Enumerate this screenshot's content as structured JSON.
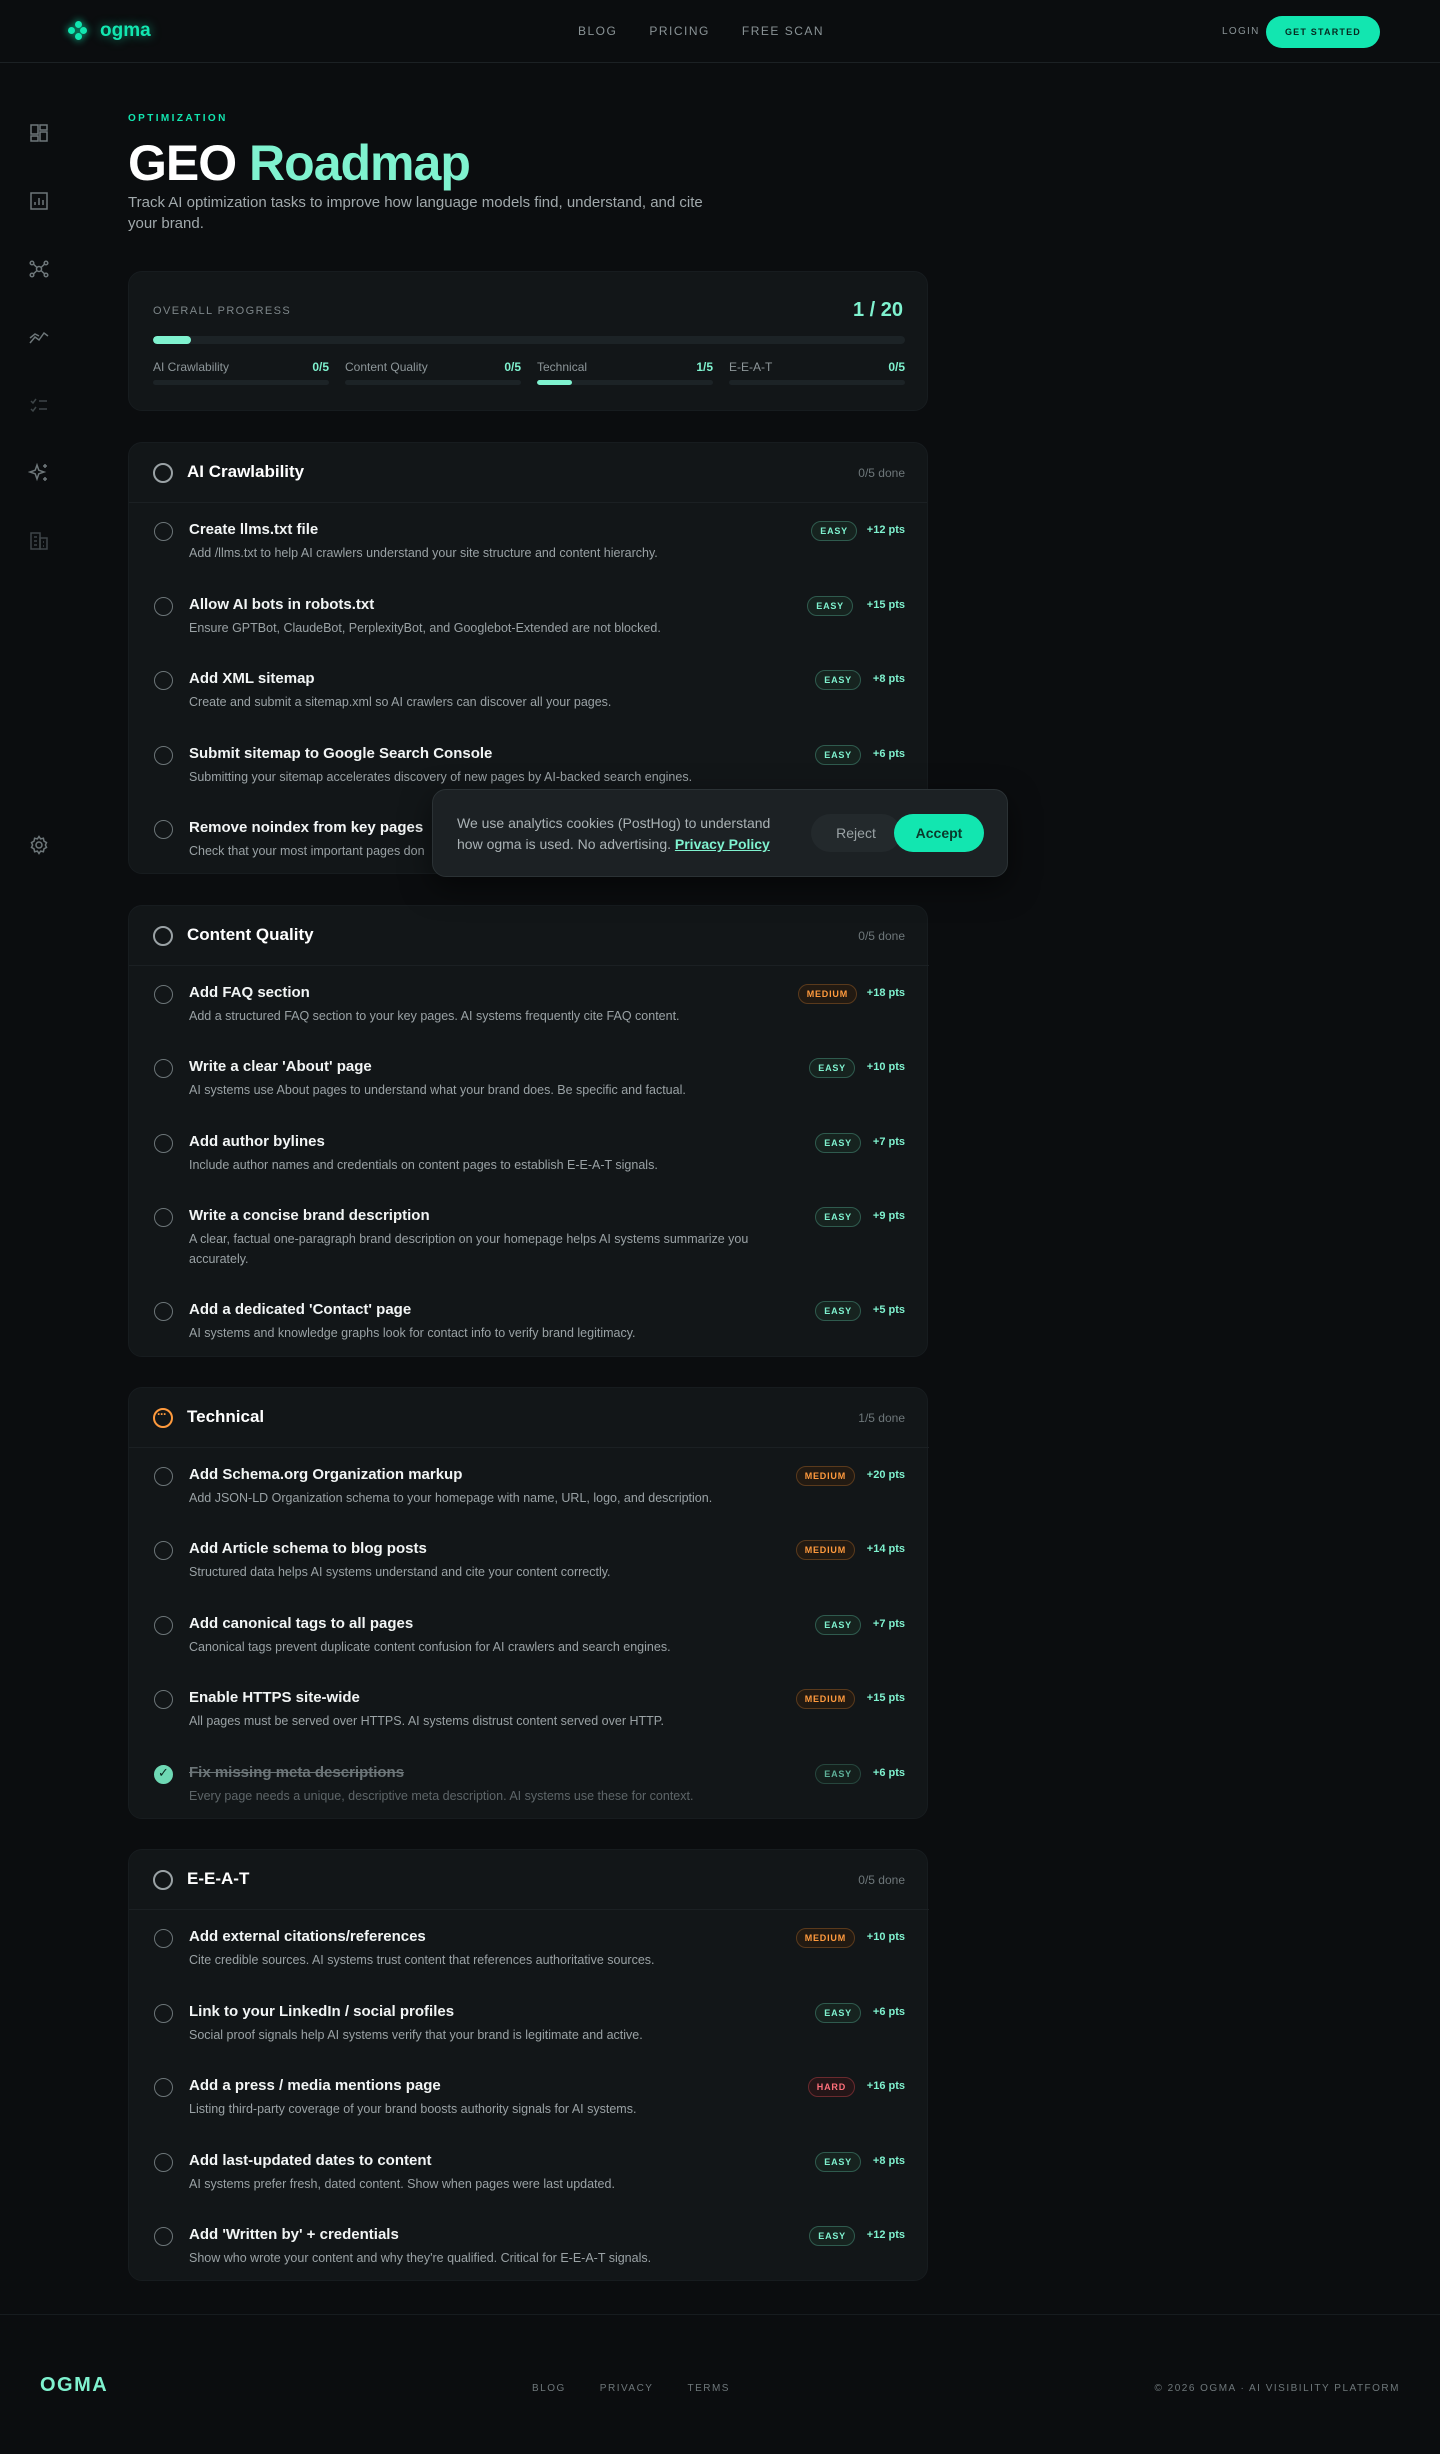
{
  "nav": {
    "logo_text": "ogma",
    "links": [
      "BLOG",
      "PRICING",
      "FREE SCAN"
    ],
    "login": "LOGIN",
    "cta": "GET STARTED"
  },
  "sidebar": {
    "icons": [
      "dashboard-icon",
      "chart-icon",
      "network-icon",
      "trend-icon",
      "checklist-icon",
      "sparkle-icon",
      "building-icon",
      "settings-icon"
    ]
  },
  "header": {
    "eyebrow": "OPTIMIZATION",
    "title_white": "GEO",
    "title_green": "Roadmap",
    "subtitle": "Track AI optimization tasks to improve how language models find, understand, and cite your brand."
  },
  "progress": {
    "label": "OVERALL PROGRESS",
    "count": "1 / 20",
    "fraction": 0.05,
    "categories": [
      {
        "name": "AI Crawlability",
        "value": "0/5",
        "fraction": 0
      },
      {
        "name": "Content Quality",
        "value": "0/5",
        "fraction": 0
      },
      {
        "name": "Technical",
        "value": "1/5",
        "fraction": 0.2
      },
      {
        "name": "E-E-A-T",
        "value": "0/5",
        "fraction": 0
      }
    ]
  },
  "sections": [
    {
      "title": "AI Crawlability",
      "done": "0/5 done",
      "tasks": [
        {
          "title": "Create llms.txt file",
          "desc": "Add /llms.txt to help AI crawlers understand your site structure and content hierarchy.",
          "badge": "EASY",
          "pts": "+12 pts"
        },
        {
          "title": "Allow AI bots in robots.txt",
          "desc": "Ensure GPTBot, ClaudeBot, PerplexityBot, and Googlebot-Extended are not blocked.",
          "badge": "EASY",
          "pts": "+15 pts"
        },
        {
          "title": "Add XML sitemap",
          "desc": "Create and submit a sitemap.xml so AI crawlers can discover all your pages.",
          "badge": "EASY",
          "pts": "+8 pts"
        },
        {
          "title": "Submit sitemap to Google Search Console",
          "desc": "Submitting your sitemap accelerates discovery of new pages by AI-backed search engines.",
          "badge": "EASY",
          "pts": "+6 pts"
        },
        {
          "title": "Remove noindex from key pages",
          "desc": "Check that your most important pages don",
          "badge": "",
          "pts": ""
        }
      ]
    },
    {
      "title": "Content Quality",
      "done": "0/5 done",
      "tasks": [
        {
          "title": "Add FAQ section",
          "desc": "Add a structured FAQ section to your key pages. AI systems frequently cite FAQ content.",
          "badge": "MEDIUM",
          "pts": "+18 pts"
        },
        {
          "title": "Write a clear 'About' page",
          "desc": "AI systems use About pages to understand what your brand does. Be specific and factual.",
          "badge": "EASY",
          "pts": "+10 pts"
        },
        {
          "title": "Add author bylines",
          "desc": "Include author names and credentials on content pages to establish E-E-A-T signals.",
          "badge": "EASY",
          "pts": "+7 pts"
        },
        {
          "title": "Write a concise brand description",
          "desc": "A clear, factual one-paragraph brand description on your homepage helps AI systems summarize you accurately.",
          "badge": "EASY",
          "pts": "+9 pts"
        },
        {
          "title": "Add a dedicated 'Contact' page",
          "desc": "AI systems and knowledge graphs look for contact info to verify brand legitimacy.",
          "badge": "EASY",
          "pts": "+5 pts"
        }
      ]
    },
    {
      "title": "Technical",
      "done": "1/5 done",
      "tasks": [
        {
          "title": "Add Schema.org Organization markup",
          "desc": "Add JSON-LD Organization schema to your homepage with name, URL, logo, and description.",
          "badge": "MEDIUM",
          "pts": "+20 pts"
        },
        {
          "title": "Add Article schema to blog posts",
          "desc": "Structured data helps AI systems understand and cite your content correctly.",
          "badge": "MEDIUM",
          "pts": "+14 pts"
        },
        {
          "title": "Add canonical tags to all pages",
          "desc": "Canonical tags prevent duplicate content confusion for AI crawlers and search engines.",
          "badge": "EASY",
          "pts": "+7 pts"
        },
        {
          "title": "Enable HTTPS site-wide",
          "desc": "All pages must be served over HTTPS. AI systems distrust content served over HTTP.",
          "badge": "MEDIUM",
          "pts": "+15 pts"
        },
        {
          "title": "Fix missing meta descriptions",
          "desc": "Every page needs a unique, descriptive meta description. AI systems use these for context.",
          "badge": "EASY",
          "pts": "+6 pts",
          "done": true
        }
      ]
    },
    {
      "title": "E-E-A-T",
      "done": "0/5 done",
      "tasks": [
        {
          "title": "Add external citations/references",
          "desc": "Cite credible sources. AI systems trust content that references authoritative sources.",
          "badge": "MEDIUM",
          "pts": "+10 pts"
        },
        {
          "title": "Link to your LinkedIn / social profiles",
          "desc": "Social proof signals help AI systems verify that your brand is legitimate and active.",
          "badge": "EASY",
          "pts": "+6 pts"
        },
        {
          "title": "Add a press / media mentions page",
          "desc": "Listing third-party coverage of your brand boosts authority signals for AI systems.",
          "badge": "HARD",
          "pts": "+16 pts"
        },
        {
          "title": "Add last-updated dates to content",
          "desc": "AI systems prefer fresh, dated content. Show when pages were last updated.",
          "badge": "EASY",
          "pts": "+8 pts"
        },
        {
          "title": "Add 'Written by' + credentials",
          "desc": "Show who wrote your content and why they're qualified. Critical for E-E-A-T signals.",
          "badge": "EASY",
          "pts": "+12 pts"
        }
      ]
    }
  ],
  "cookie": {
    "text": "We use analytics cookies (PostHog) to understand how ogma is used. No advertising.",
    "link": "Privacy Policy",
    "reject": "Reject",
    "accept": "Accept"
  },
  "footer": {
    "logo": "OGMA",
    "links": [
      "BLOG",
      "PRIVACY",
      "TERMS"
    ],
    "copyright": "© 2026 OGMA · AI VISIBILITY PLATFORM"
  }
}
